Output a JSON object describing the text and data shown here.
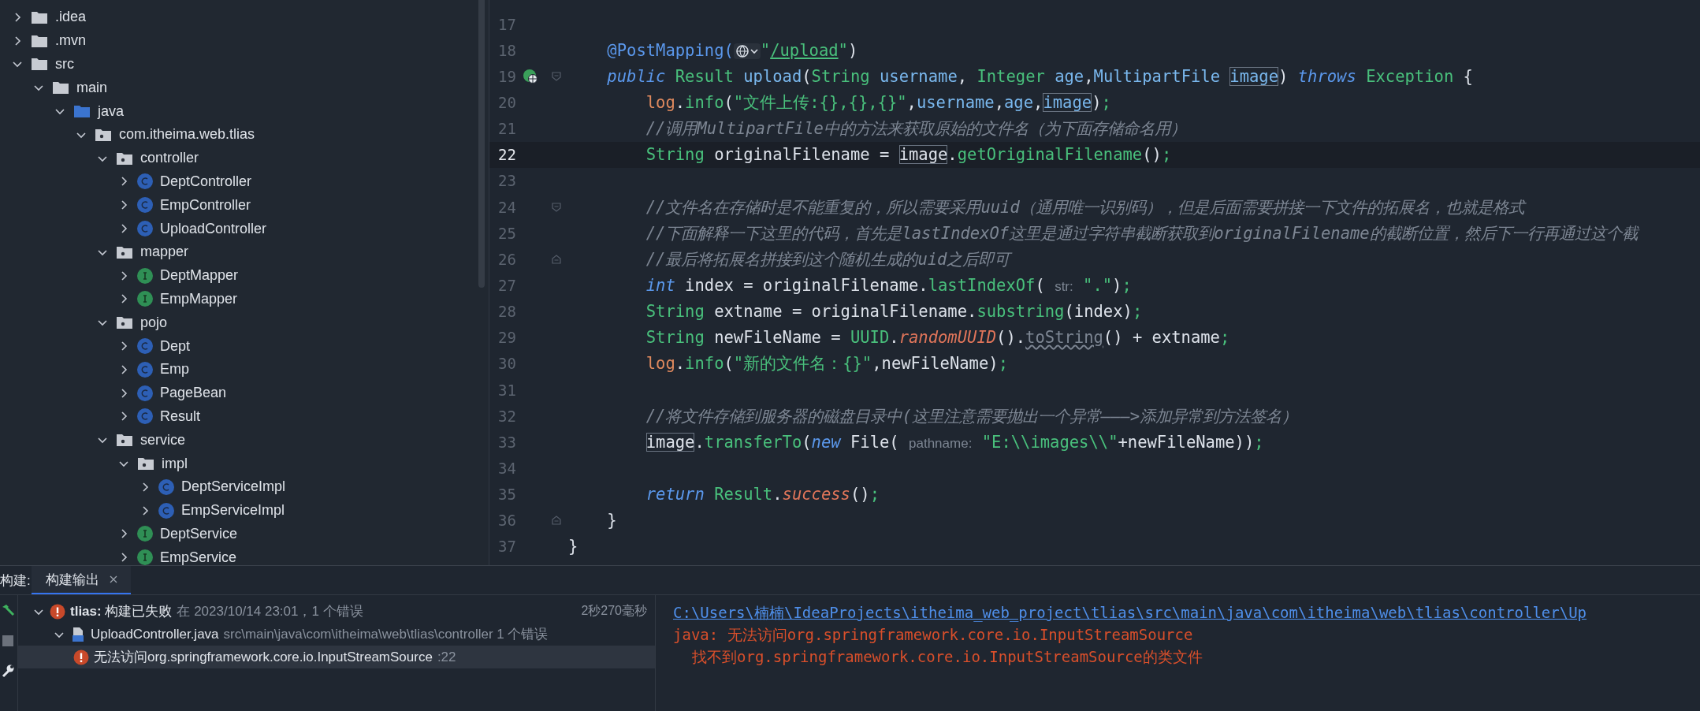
{
  "project_tree": [
    {
      "label": ".idea",
      "kind": "folder",
      "expanded": false
    },
    {
      "label": ".mvn",
      "kind": "folder",
      "expanded": false
    },
    {
      "label": "src",
      "kind": "folder",
      "expanded": true,
      "children": [
        {
          "label": "main",
          "kind": "folder",
          "expanded": true,
          "children": [
            {
              "label": "java",
              "kind": "source-folder",
              "expanded": true,
              "children": [
                {
                  "label": "com.itheima.web.tlias",
                  "kind": "package",
                  "expanded": true,
                  "children": [
                    {
                      "label": "controller",
                      "kind": "package",
                      "expanded": true,
                      "children": [
                        {
                          "label": "DeptController",
                          "kind": "class",
                          "expanded": false
                        },
                        {
                          "label": "EmpController",
                          "kind": "class",
                          "expanded": false
                        },
                        {
                          "label": "UploadController",
                          "kind": "class",
                          "expanded": false
                        }
                      ]
                    },
                    {
                      "label": "mapper",
                      "kind": "package",
                      "expanded": true,
                      "children": [
                        {
                          "label": "DeptMapper",
                          "kind": "interface",
                          "expanded": false
                        },
                        {
                          "label": "EmpMapper",
                          "kind": "interface",
                          "expanded": false
                        }
                      ]
                    },
                    {
                      "label": "pojo",
                      "kind": "package",
                      "expanded": true,
                      "children": [
                        {
                          "label": "Dept",
                          "kind": "class",
                          "expanded": false
                        },
                        {
                          "label": "Emp",
                          "kind": "class",
                          "expanded": false
                        },
                        {
                          "label": "PageBean",
                          "kind": "class",
                          "expanded": false
                        },
                        {
                          "label": "Result",
                          "kind": "class",
                          "expanded": false
                        }
                      ]
                    },
                    {
                      "label": "service",
                      "kind": "package",
                      "expanded": true,
                      "children": [
                        {
                          "label": "impl",
                          "kind": "package",
                          "expanded": true,
                          "children": [
                            {
                              "label": "DeptServiceImpl",
                              "kind": "class",
                              "expanded": false
                            },
                            {
                              "label": "EmpServiceImpl",
                              "kind": "class",
                              "expanded": false
                            }
                          ]
                        },
                        {
                          "label": "DeptService",
                          "kind": "interface",
                          "expanded": false
                        },
                        {
                          "label": "EmpService",
                          "kind": "interface",
                          "expanded": false
                        }
                      ]
                    }
                  ]
                }
              ]
            }
          ]
        }
      ]
    }
  ],
  "editor": {
    "lines": [
      {
        "n": "17",
        "current": false
      },
      {
        "n": "18",
        "current": false,
        "tokens": [
          {
            "kind": "annot",
            "t": "    @PostMapping("
          },
          {
            "kind": "inlay"
          },
          {
            "kind": "str",
            "t": "\""
          },
          {
            "kind": "url",
            "t": "/upload"
          },
          {
            "kind": "str",
            "t": "\""
          },
          {
            "kind": "plain",
            "t": ")"
          }
        ]
      },
      {
        "n": "19",
        "current": false,
        "run_marker": true,
        "fold_start": true,
        "tokens": [
          {
            "kind": "kw",
            "t": "    public"
          },
          {
            "kind": "type",
            "t": " Result"
          },
          {
            "kind": "decl",
            "t": " upload"
          },
          {
            "kind": "plain",
            "t": "("
          },
          {
            "kind": "type",
            "t": "String"
          },
          {
            "kind": "decl",
            "t": " username"
          },
          {
            "kind": "plain",
            "t": ", "
          },
          {
            "kind": "type",
            "t": "Integer"
          },
          {
            "kind": "decl",
            "t": " age"
          },
          {
            "kind": "plain",
            "t": ","
          },
          {
            "kind": "decl",
            "t": "MultipartFile "
          },
          {
            "kind": "decl-box",
            "t": "image"
          },
          {
            "kind": "plain",
            "t": ") "
          },
          {
            "kind": "kw",
            "t": "throws"
          },
          {
            "kind": "type",
            "t": " Exception"
          },
          {
            "kind": "plain",
            "t": " {"
          }
        ]
      },
      {
        "n": "20",
        "current": false,
        "tokens": [
          {
            "kind": "field",
            "t": "        log"
          },
          {
            "kind": "plain",
            "t": "."
          },
          {
            "kind": "call",
            "t": "info"
          },
          {
            "kind": "plain",
            "t": "("
          },
          {
            "kind": "str",
            "t": "\"文件上传:{},{},{}\""
          },
          {
            "kind": "plain",
            "t": ","
          },
          {
            "kind": "decl",
            "t": "username"
          },
          {
            "kind": "plain",
            "t": ","
          },
          {
            "kind": "decl",
            "t": "age"
          },
          {
            "kind": "plain",
            "t": ","
          },
          {
            "kind": "decl-box",
            "t": "image"
          },
          {
            "kind": "plain",
            "t": ")"
          },
          {
            "kind": "semi",
            "t": ";"
          }
        ]
      },
      {
        "n": "21",
        "current": false,
        "tokens": [
          {
            "kind": "comment",
            "t": "        //调用MultipartFile中的方法来获取原始的文件名（为下面存储命名用）"
          }
        ]
      },
      {
        "n": "22",
        "current": true,
        "tokens": [
          {
            "kind": "type",
            "t": "        String"
          },
          {
            "kind": "plain",
            "t": " originalFilename = "
          },
          {
            "kind": "plain-box",
            "t": "image"
          },
          {
            "kind": "plain",
            "t": "."
          },
          {
            "kind": "call",
            "t": "getOriginalFilename"
          },
          {
            "kind": "plain",
            "t": "()"
          },
          {
            "kind": "semi",
            "t": ";"
          }
        ]
      },
      {
        "n": "23",
        "current": false
      },
      {
        "n": "24",
        "current": false,
        "fold_start": true,
        "tokens": [
          {
            "kind": "comment",
            "t": "        //文件名在存储时是不能重复的，所以需要采用uuid（通用唯一识别码），但是后面需要拼接一下文件的拓展名，也就是格式"
          }
        ]
      },
      {
        "n": "25",
        "current": false,
        "tokens": [
          {
            "kind": "comment",
            "t": "        //下面解释一下这里的代码，首先是lastIndexOf这里是通过字符串截断获取到originalFilename的截断位置，然后下一行再通过这个截"
          }
        ]
      },
      {
        "n": "26",
        "current": false,
        "fold_end": true,
        "tokens": [
          {
            "kind": "comment",
            "t": "        //最后将拓展名拼接到这个随机生成的uid之后即可"
          }
        ]
      },
      {
        "n": "27",
        "current": false,
        "tokens": [
          {
            "kind": "kw",
            "t": "        int"
          },
          {
            "kind": "plain",
            "t": " index = originalFilename."
          },
          {
            "kind": "call",
            "t": "lastIndexOf"
          },
          {
            "kind": "plain",
            "t": "( "
          },
          {
            "kind": "hint",
            "t": "str:"
          },
          {
            "kind": "str",
            "t": " \".\""
          },
          {
            "kind": "plain",
            "t": ")"
          },
          {
            "kind": "semi",
            "t": ";"
          }
        ]
      },
      {
        "n": "28",
        "current": false,
        "tokens": [
          {
            "kind": "type",
            "t": "        String"
          },
          {
            "kind": "plain",
            "t": " extname = originalFilename."
          },
          {
            "kind": "call",
            "t": "substring"
          },
          {
            "kind": "plain",
            "t": "(index)"
          },
          {
            "kind": "semi",
            "t": ";"
          }
        ]
      },
      {
        "n": "29",
        "current": false,
        "tokens": [
          {
            "kind": "type",
            "t": "        String"
          },
          {
            "kind": "plain",
            "t": " newFileName = "
          },
          {
            "kind": "type",
            "t": "UUID"
          },
          {
            "kind": "plain",
            "t": "."
          },
          {
            "kind": "static",
            "t": "randomUUID"
          },
          {
            "kind": "plain",
            "t": "()."
          },
          {
            "kind": "deprecated",
            "t": "toString"
          },
          {
            "kind": "plain",
            "t": "() + extname"
          },
          {
            "kind": "semi",
            "t": ";"
          }
        ]
      },
      {
        "n": "30",
        "current": false,
        "tokens": [
          {
            "kind": "field",
            "t": "        log"
          },
          {
            "kind": "plain",
            "t": "."
          },
          {
            "kind": "call",
            "t": "info"
          },
          {
            "kind": "plain",
            "t": "("
          },
          {
            "kind": "str",
            "t": "\"新的文件名：{}\""
          },
          {
            "kind": "plain",
            "t": ",newFileName)"
          },
          {
            "kind": "semi",
            "t": ";"
          }
        ]
      },
      {
        "n": "31",
        "current": false
      },
      {
        "n": "32",
        "current": false,
        "tokens": [
          {
            "kind": "comment",
            "t": "        //将文件存储到服务器的磁盘目录中(这里注意需要抛出一个异常———>添加异常到方法签名）"
          }
        ]
      },
      {
        "n": "33",
        "current": false,
        "tokens": [
          {
            "kind": "plain-box",
            "t": "        image"
          },
          {
            "kind": "plain",
            "t": "."
          },
          {
            "kind": "call",
            "t": "transferTo"
          },
          {
            "kind": "plain",
            "t": "("
          },
          {
            "kind": "kw",
            "t": "new"
          },
          {
            "kind": "plain",
            "t": " File( "
          },
          {
            "kind": "hint",
            "t": "pathname:"
          },
          {
            "kind": "str",
            "t": " \"E:\\\\images\\\\\""
          },
          {
            "kind": "plain",
            "t": "+newFileName))"
          },
          {
            "kind": "semi",
            "t": ";"
          }
        ]
      },
      {
        "n": "34",
        "current": false
      },
      {
        "n": "35",
        "current": false,
        "tokens": [
          {
            "kind": "kw",
            "t": "        return"
          },
          {
            "kind": "type",
            "t": " Result"
          },
          {
            "kind": "plain",
            "t": "."
          },
          {
            "kind": "static",
            "t": "success"
          },
          {
            "kind": "plain",
            "t": "()"
          },
          {
            "kind": "semi",
            "t": ";"
          }
        ]
      },
      {
        "n": "36",
        "current": false,
        "fold_end": true,
        "tokens": [
          {
            "kind": "plain",
            "t": "    }"
          }
        ]
      },
      {
        "n": "37",
        "current": false,
        "tokens": [
          {
            "kind": "plain",
            "t": "}"
          }
        ]
      }
    ]
  },
  "build_panel": {
    "label": "构建:",
    "tabs": [
      {
        "label": "构建输出",
        "selected": true
      }
    ],
    "tree": [
      {
        "kind": "summary",
        "title": "**tlias:** 构建已失败",
        "detail": "在 2023/10/14 23:01，1 个错误",
        "duration": "2秒270毫秒",
        "expanded": true,
        "selected": false,
        "children": [
          {
            "kind": "file",
            "title": "UploadController.java",
            "detail": "src\\main\\java\\com\\itheima\\web\\tlias\\controller 1 个错误",
            "expanded": true,
            "selected": false,
            "children": [
              {
                "kind": "error",
                "title": "无法访问org.springframework.core.io.InputStreamSource",
                "detail": ":22",
                "selected": true
              }
            ]
          }
        ]
      }
    ],
    "output": [
      {
        "kind": "link",
        "text": "C:\\Users\\楠楠\\IdeaProjects\\itheima_web_project\\tlias\\src\\main\\java\\com\\itheima\\web\\tlias\\controller\\Up"
      },
      {
        "kind": "error",
        "text": "java: 无法访问org.springframework.core.io.InputStreamSource"
      },
      {
        "kind": "error-detail",
        "text": "找不到org.springframework.core.io.InputStreamSource的类文件"
      }
    ]
  }
}
